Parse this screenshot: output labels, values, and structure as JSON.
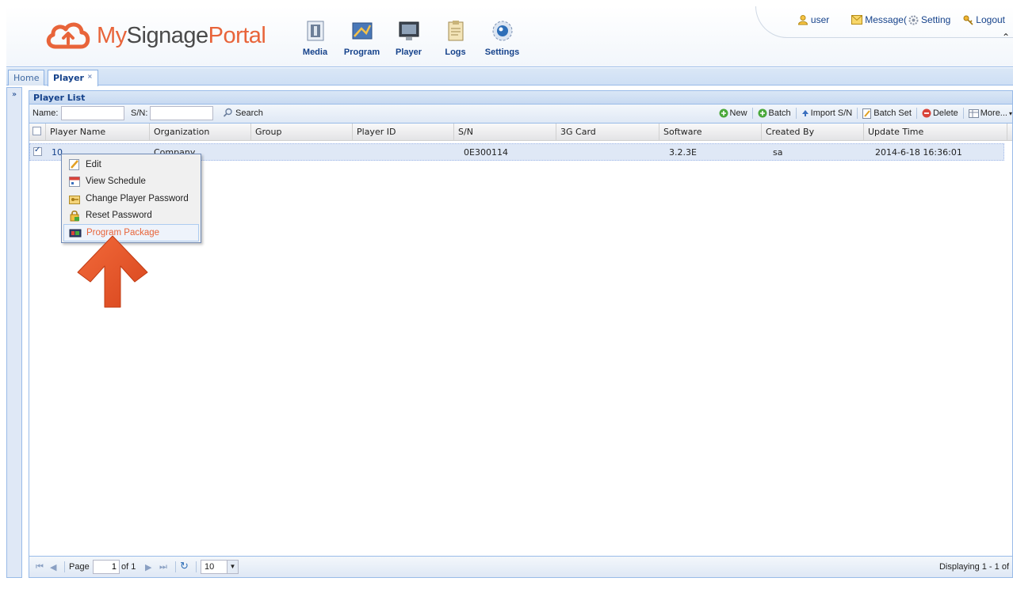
{
  "header": {
    "logo": {
      "part1": "My",
      "part2": "Signage",
      "part3": "Portal"
    },
    "nav": [
      {
        "label": "Media",
        "icon": "film-icon"
      },
      {
        "label": "Program",
        "icon": "picture-icon"
      },
      {
        "label": "Player",
        "icon": "monitor-icon"
      },
      {
        "label": "Logs",
        "icon": "clipboard-icon"
      },
      {
        "label": "Settings",
        "icon": "gear-globe-icon"
      }
    ],
    "top_links": {
      "user": "user",
      "message": "Message(",
      "setting": "Setting",
      "logout": "Logout"
    }
  },
  "tabs": [
    {
      "label": "Home",
      "active": false
    },
    {
      "label": "Player",
      "active": true,
      "close": "×"
    }
  ],
  "collapse_symbol": "»",
  "panel": {
    "title": "Player List",
    "toolbar": {
      "name_label": "Name:",
      "name_value": "",
      "sn_label": "S/N:",
      "sn_value": "",
      "search": "Search",
      "new": "New",
      "batch": "Batch",
      "import_sn": "Import S/N",
      "batch_set": "Batch Set",
      "delete": "Delete",
      "more": "More..."
    },
    "columns": [
      "Player Name",
      "Organization",
      "Group",
      "Player ID",
      "S/N",
      "3G Card",
      "Software",
      "Created By",
      "Update Time"
    ],
    "rows": [
      {
        "checked": true,
        "player_name": "10",
        "organization": "Company",
        "group": "",
        "player_id": "",
        "sn": "0E300114",
        "card": "",
        "software": "3.2.3E",
        "created_by": "sa",
        "update_time": "2014-6-18 16:36:01"
      }
    ]
  },
  "context_menu": [
    {
      "label": "Edit",
      "icon": "edit-icon",
      "active": false
    },
    {
      "label": "View Schedule",
      "icon": "calendar-icon",
      "active": false
    },
    {
      "label": "Change Player Password",
      "icon": "key-folder-icon",
      "active": false
    },
    {
      "label": "Reset Password",
      "icon": "lock-icon",
      "active": false
    },
    {
      "label": "Program Package",
      "icon": "package-icon",
      "active": true
    }
  ],
  "paging": {
    "page_label": "Page",
    "page_value": "1",
    "of_label": "of 1",
    "page_size": "10",
    "display": "Displaying 1 - 1 of"
  },
  "colors": {
    "accent": "#e8643a",
    "header_text": "#15428b",
    "grid_border": "#99bbe8"
  }
}
